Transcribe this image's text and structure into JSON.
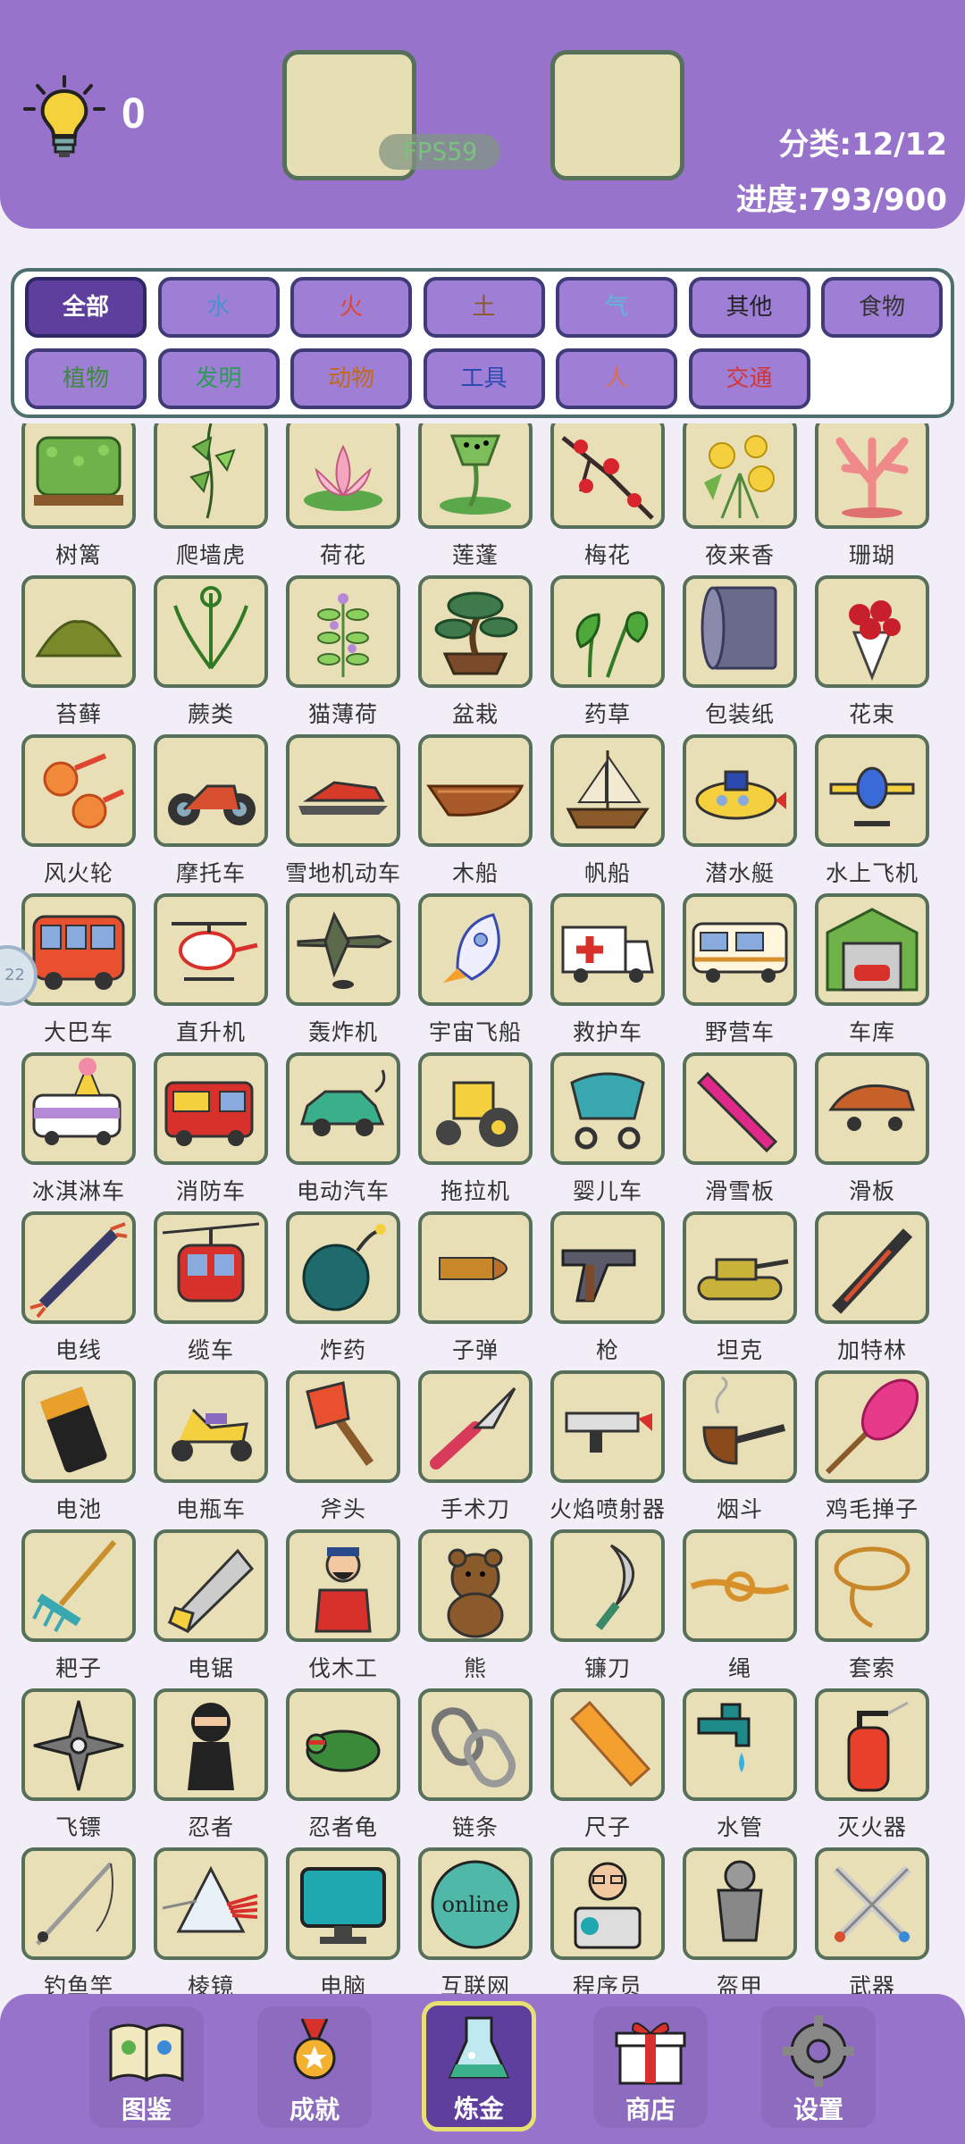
{
  "header": {
    "hint_count": "0",
    "fps": "FPS59",
    "category_stat": "分类:12/12",
    "progress_stat": "进度:793/900"
  },
  "filters": [
    {
      "label": "全部",
      "color": "#ffffff",
      "active": true
    },
    {
      "label": "水",
      "color": "#4a8fd0"
    },
    {
      "label": "火",
      "color": "#e0452f"
    },
    {
      "label": "土",
      "color": "#8a5a2c"
    },
    {
      "label": "气",
      "color": "#5fb7d8"
    },
    {
      "label": "其他",
      "color": "#222222"
    },
    {
      "label": "食物",
      "color": "#333333"
    },
    {
      "label": "植物",
      "color": "#3d8a3a"
    },
    {
      "label": "发明",
      "color": "#2f9a57"
    },
    {
      "label": "动物",
      "color": "#c06a1a"
    },
    {
      "label": "工具",
      "color": "#2b4bb0"
    },
    {
      "label": "人",
      "color": "#d87050"
    },
    {
      "label": "交通",
      "color": "#d03838"
    }
  ],
  "items": [
    {
      "label": "树篱",
      "icon": "hedge-icon"
    },
    {
      "label": "爬墙虎",
      "icon": "ivy-icon"
    },
    {
      "label": "荷花",
      "icon": "lotus-icon"
    },
    {
      "label": "莲蓬",
      "icon": "lotus-pod-icon"
    },
    {
      "label": "梅花",
      "icon": "plum-blossom-icon"
    },
    {
      "label": "夜来香",
      "icon": "night-flower-icon"
    },
    {
      "label": "珊瑚",
      "icon": "coral-icon"
    },
    {
      "label": "苔藓",
      "icon": "moss-icon"
    },
    {
      "label": "蕨类",
      "icon": "fern-icon"
    },
    {
      "label": "猫薄荷",
      "icon": "catnip-icon"
    },
    {
      "label": "盆栽",
      "icon": "bonsai-icon"
    },
    {
      "label": "药草",
      "icon": "herb-icon"
    },
    {
      "label": "包装纸",
      "icon": "wrapping-paper-icon"
    },
    {
      "label": "花束",
      "icon": "bouquet-icon"
    },
    {
      "label": "风火轮",
      "icon": "fire-wheels-icon"
    },
    {
      "label": "摩托车",
      "icon": "motorcycle-icon"
    },
    {
      "label": "雪地机动车",
      "icon": "snowmobile-icon"
    },
    {
      "label": "木船",
      "icon": "wooden-boat-icon"
    },
    {
      "label": "帆船",
      "icon": "sailboat-icon"
    },
    {
      "label": "潜水艇",
      "icon": "submarine-icon"
    },
    {
      "label": "水上飞机",
      "icon": "seaplane-icon"
    },
    {
      "label": "大巴车",
      "icon": "bus-icon"
    },
    {
      "label": "直升机",
      "icon": "helicopter-icon"
    },
    {
      "label": "轰炸机",
      "icon": "bomber-icon"
    },
    {
      "label": "宇宙飞船",
      "icon": "rocket-icon"
    },
    {
      "label": "救护车",
      "icon": "ambulance-icon"
    },
    {
      "label": "野营车",
      "icon": "camper-icon"
    },
    {
      "label": "车库",
      "icon": "garage-icon"
    },
    {
      "label": "冰淇淋车",
      "icon": "ice-cream-truck-icon"
    },
    {
      "label": "消防车",
      "icon": "fire-truck-icon"
    },
    {
      "label": "电动汽车",
      "icon": "electric-car-icon"
    },
    {
      "label": "拖拉机",
      "icon": "tractor-icon"
    },
    {
      "label": "婴儿车",
      "icon": "stroller-icon"
    },
    {
      "label": "滑雪板",
      "icon": "snowboard-icon"
    },
    {
      "label": "滑板",
      "icon": "skateboard-icon"
    },
    {
      "label": "电线",
      "icon": "wire-icon"
    },
    {
      "label": "缆车",
      "icon": "cable-car-icon"
    },
    {
      "label": "炸药",
      "icon": "bomb-icon"
    },
    {
      "label": "子弹",
      "icon": "bullet-icon"
    },
    {
      "label": "枪",
      "icon": "revolver-icon"
    },
    {
      "label": "坦克",
      "icon": "tank-icon"
    },
    {
      "label": "加特林",
      "icon": "gatling-icon"
    },
    {
      "label": "电池",
      "icon": "battery-icon"
    },
    {
      "label": "电瓶车",
      "icon": "scooter-icon"
    },
    {
      "label": "斧头",
      "icon": "axe-icon"
    },
    {
      "label": "手术刀",
      "icon": "scalpel-icon"
    },
    {
      "label": "火焰喷射器",
      "icon": "flamethrower-icon"
    },
    {
      "label": "烟斗",
      "icon": "pipe-icon"
    },
    {
      "label": "鸡毛掸子",
      "icon": "feather-duster-icon"
    },
    {
      "label": "耙子",
      "icon": "rake-icon"
    },
    {
      "label": "电锯",
      "icon": "saw-icon"
    },
    {
      "label": "伐木工",
      "icon": "lumberjack-icon"
    },
    {
      "label": "熊",
      "icon": "bear-icon"
    },
    {
      "label": "镰刀",
      "icon": "sickle-icon"
    },
    {
      "label": "绳",
      "icon": "rope-icon"
    },
    {
      "label": "套索",
      "icon": "lasso-icon"
    },
    {
      "label": "飞镖",
      "icon": "shuriken-icon"
    },
    {
      "label": "忍者",
      "icon": "ninja-icon"
    },
    {
      "label": "忍者龟",
      "icon": "ninja-turtle-icon"
    },
    {
      "label": "链条",
      "icon": "chain-icon"
    },
    {
      "label": "尺子",
      "icon": "ruler-icon"
    },
    {
      "label": "水管",
      "icon": "faucet-icon"
    },
    {
      "label": "灭火器",
      "icon": "extinguisher-icon"
    },
    {
      "label": "钓鱼竿",
      "icon": "fishing-rod-icon"
    },
    {
      "label": "棱镜",
      "icon": "prism-icon"
    },
    {
      "label": "电脑",
      "icon": "computer-icon"
    },
    {
      "label": "互联网",
      "icon": "internet-icon",
      "text": "online"
    },
    {
      "label": "程序员",
      "icon": "programmer-icon"
    },
    {
      "label": "盔甲",
      "icon": "armor-icon"
    },
    {
      "label": "武器",
      "icon": "weapons-icon"
    }
  ],
  "float_button": "22",
  "nav": [
    {
      "label": "图鉴",
      "icon": "book-icon"
    },
    {
      "label": "成就",
      "icon": "medal-icon"
    },
    {
      "label": "炼金",
      "icon": "flask-icon",
      "active": true
    },
    {
      "label": "商店",
      "icon": "gift-icon"
    },
    {
      "label": "设置",
      "icon": "gear-icon"
    }
  ]
}
